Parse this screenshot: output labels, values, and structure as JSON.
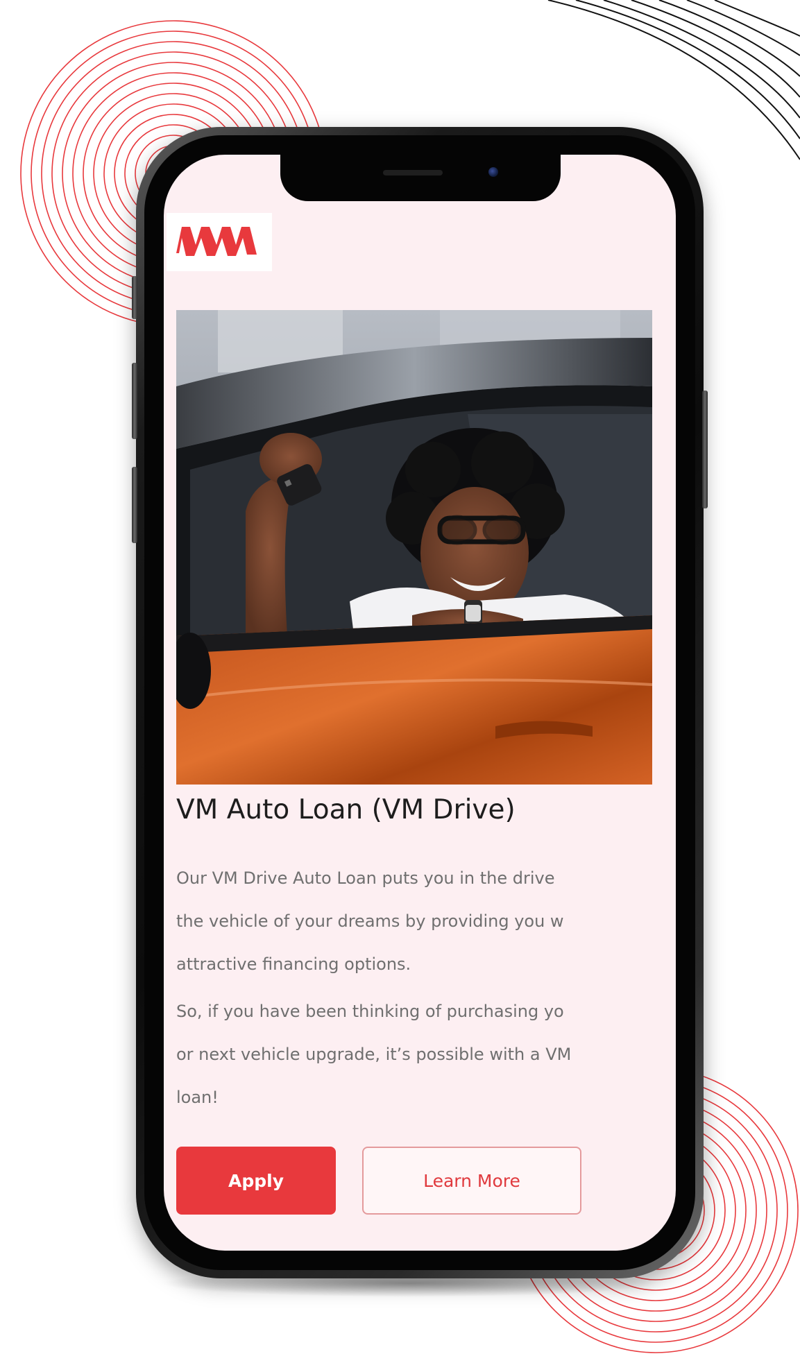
{
  "brand": {
    "logo_icon": "vm-logo-icon",
    "accent_color": "#e8393d",
    "background_tint": "#fdeff2"
  },
  "hero": {
    "image_icon": "woman-holding-car-key-photo"
  },
  "content": {
    "title": "VM Auto Loan (VM Drive)",
    "paragraph1_lines": [
      "Our VM Drive Auto Loan puts you in the drive",
      "the vehicle of your dreams by providing you w",
      "attractive financing options."
    ],
    "paragraph2_lines": [
      "So, if you have been thinking of purchasing yo",
      "or next vehicle upgrade, it’s possible with a VM",
      "loan!"
    ]
  },
  "actions": {
    "apply_label": "Apply",
    "learn_more_label": "Learn More"
  }
}
